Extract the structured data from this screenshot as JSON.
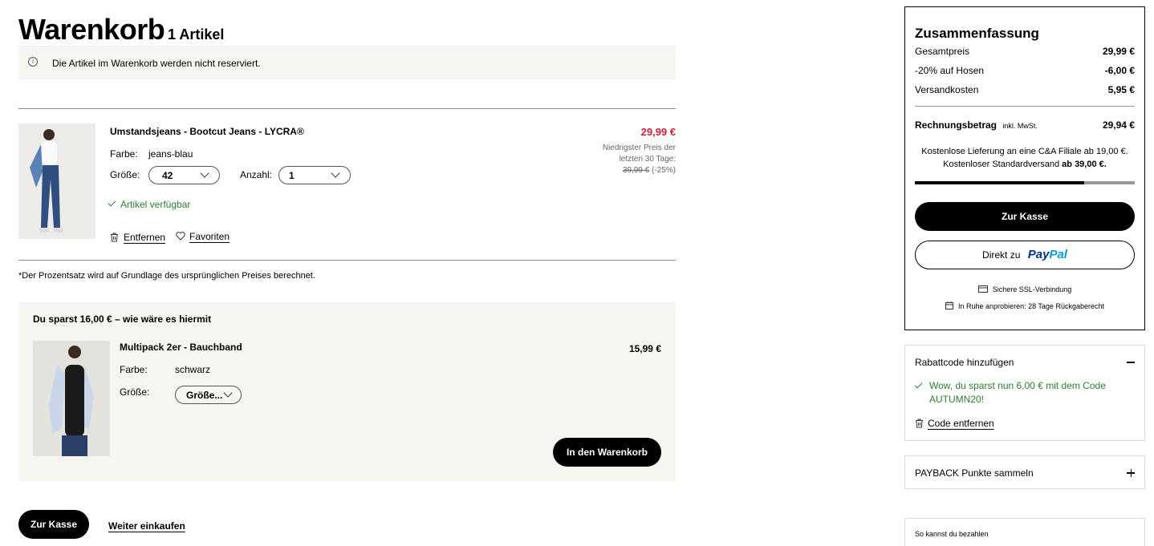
{
  "cart": {
    "title": "Warenkorb",
    "count": "1 Artikel",
    "notice": "Die Artikel im Warenkorb werden nicht reserviert."
  },
  "item": {
    "name": "Umstandsjeans - Bootcut Jeans - LYCRA®",
    "color_label": "Farbe:",
    "color_value": "jeans-blau",
    "size_label": "Größe:",
    "size_value": "42",
    "qty_label": "Anzahl:",
    "qty_value": "1",
    "availability": "Artikel verfügbar",
    "remove_label": "Entfernen",
    "favorite_label": "Favoriten",
    "price": "29,99 €",
    "lowest_line1": "Niedrigster Preis der",
    "lowest_line2": "letzten 30 Tage:",
    "old_price": "39,99 €",
    "discount": "(-25%)"
  },
  "footnote": "*Der Prozentsatz wird auf Grundlage des ursprünglichen Preises berechnet.",
  "upsell": {
    "heading": "Du sparst 16,00 € – wie wäre es hiermit",
    "name": "Multipack 2er - Bauchband",
    "price": "15,99 €",
    "color_label": "Farbe:",
    "color_value": "schwarz",
    "size_label": "Größe:",
    "size_value": "Größe...",
    "add_button": "In den Warenkorb"
  },
  "actions": {
    "checkout": "Zur Kasse",
    "continue": "Weiter einkaufen"
  },
  "summary": {
    "title": "Zusammenfassung",
    "rows": [
      {
        "label": "Gesamtpreis",
        "value": "29,99 €"
      },
      {
        "label": "-20% auf Hosen",
        "value": "-6,00 €"
      },
      {
        "label": "Versandkosten",
        "value": "5,95 €"
      }
    ],
    "total_label": "Rechnungsbetrag",
    "total_note": "inkl. MwSt.",
    "total_value": "29,94 €",
    "shipping_line1": "Kostenlose Lieferung an eine C&A Filiale ab 19,00 €.",
    "shipping_line2_prefix": "Kostenloser Standardversand",
    "shipping_line2_bold": "ab 39,00 €.",
    "progress": 0.77,
    "checkout_button": "Zur Kasse",
    "paypal_prefix": "Direkt zu",
    "paypal_pay": "Pay",
    "paypal_pal": "Pal",
    "ssl": "Sichere SSL-Verbindung",
    "returns": "In Ruhe anprobieren: 28 Tage Rückgaberecht"
  },
  "coupon": {
    "title": "Rabattcode hinzufügen",
    "success_line1": "Wow, du sparst nun 6,00 € mit dem Code",
    "success_line2": "AUTUMN20!",
    "remove": "Code entfernen"
  },
  "payback": {
    "title": "PAYBACK Punkte sammeln"
  },
  "payment": {
    "title": "So kannst du bezahlen"
  },
  "colors": {
    "accent_red": "#cc1f3c",
    "green": "#2e7d32",
    "paypal_dark": "#003087",
    "paypal_light": "#009cde",
    "beige": "#f7f5ef"
  }
}
